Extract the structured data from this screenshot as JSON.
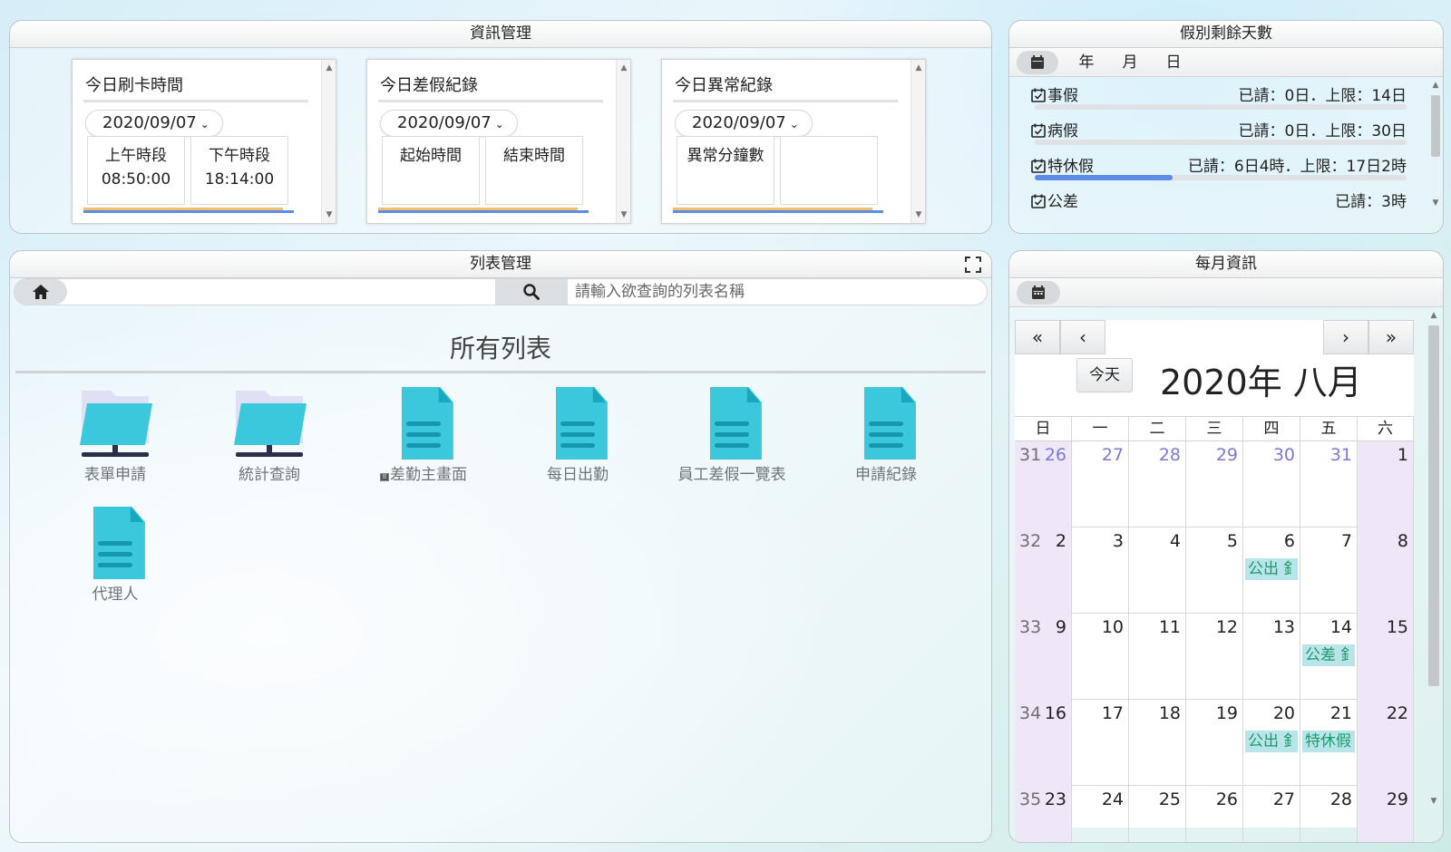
{
  "info_panel": {
    "title": "資訊管理",
    "cards": [
      {
        "title": "今日刷卡時間",
        "date": "2020/09/07",
        "cells": [
          "上午時段\n08:50:00",
          "下午時段\n18:14:00"
        ]
      },
      {
        "title": "今日差假紀錄",
        "date": "2020/09/07",
        "cells": [
          "起始時間",
          "結束時間"
        ]
      },
      {
        "title": "今日異常紀錄",
        "date": "2020/09/07",
        "cells": [
          "異常分鐘數",
          ""
        ]
      }
    ]
  },
  "leave_panel": {
    "title": "假別剩餘天數",
    "tabs": [
      "年",
      "月",
      "日"
    ],
    "rows": [
      {
        "type": "事假",
        "detail": "已請：0日．上限：14日",
        "used_fraction": 0
      },
      {
        "type": "病假",
        "detail": "已請：0日．上限：30日",
        "used_fraction": 0
      },
      {
        "type": "特休假",
        "detail": "已請：6日4時．上限：17日2時",
        "used_fraction": 0.37
      },
      {
        "type": "公差",
        "detail": "已請：3時",
        "used_fraction": null
      }
    ]
  },
  "list_panel": {
    "title": "列表管理",
    "search_placeholder": "請輸入欲查詢的列表名稱",
    "heading": "所有列表",
    "items": [
      {
        "label": "表單申請",
        "kind": "folder"
      },
      {
        "label": "統計查詢",
        "kind": "folder"
      },
      {
        "label": "差勤主畫面",
        "kind": "doc"
      },
      {
        "label": "每日出勤",
        "kind": "doc"
      },
      {
        "label": "員工差假一覽表",
        "kind": "doc"
      },
      {
        "label": "申請紀錄",
        "kind": "doc"
      },
      {
        "label": "代理人",
        "kind": "doc"
      }
    ]
  },
  "calendar_panel": {
    "title": "每月資訊",
    "today_label": "今天",
    "month_title": "2020年 八月",
    "weekdays": [
      "日",
      "一",
      "二",
      "三",
      "四",
      "五",
      "六"
    ],
    "weeks": [
      {
        "week": "31",
        "days": [
          "26",
          "27",
          "28",
          "29",
          "30",
          "31",
          "1"
        ]
      },
      {
        "week": "32",
        "days": [
          "2",
          "3",
          "4",
          "5",
          "6",
          "7",
          "8"
        ]
      },
      {
        "week": "33",
        "days": [
          "9",
          "10",
          "11",
          "12",
          "13",
          "14",
          "15"
        ]
      },
      {
        "week": "34",
        "days": [
          "16",
          "17",
          "18",
          "19",
          "20",
          "21",
          "22"
        ]
      },
      {
        "week": "35",
        "days": [
          "23",
          "24",
          "25",
          "26",
          "27",
          "28",
          "29"
        ]
      }
    ],
    "events": [
      {
        "day": "6",
        "label": "公出 釒"
      },
      {
        "day": "14",
        "label": "公差 釒"
      },
      {
        "day": "20",
        "label": "公出 釒"
      },
      {
        "day": "21",
        "label": "特休假"
      }
    ],
    "colors": {
      "weekend": "#efe6f7",
      "other_month": "#7a7ad6",
      "event_bg": "#b9e5ea",
      "event_text": "#1c9b6a"
    }
  },
  "colors": {
    "accent_blue": "#5b8de8",
    "accent_orange": "#f5c06a",
    "icon_teal": "#3cc8dc"
  }
}
